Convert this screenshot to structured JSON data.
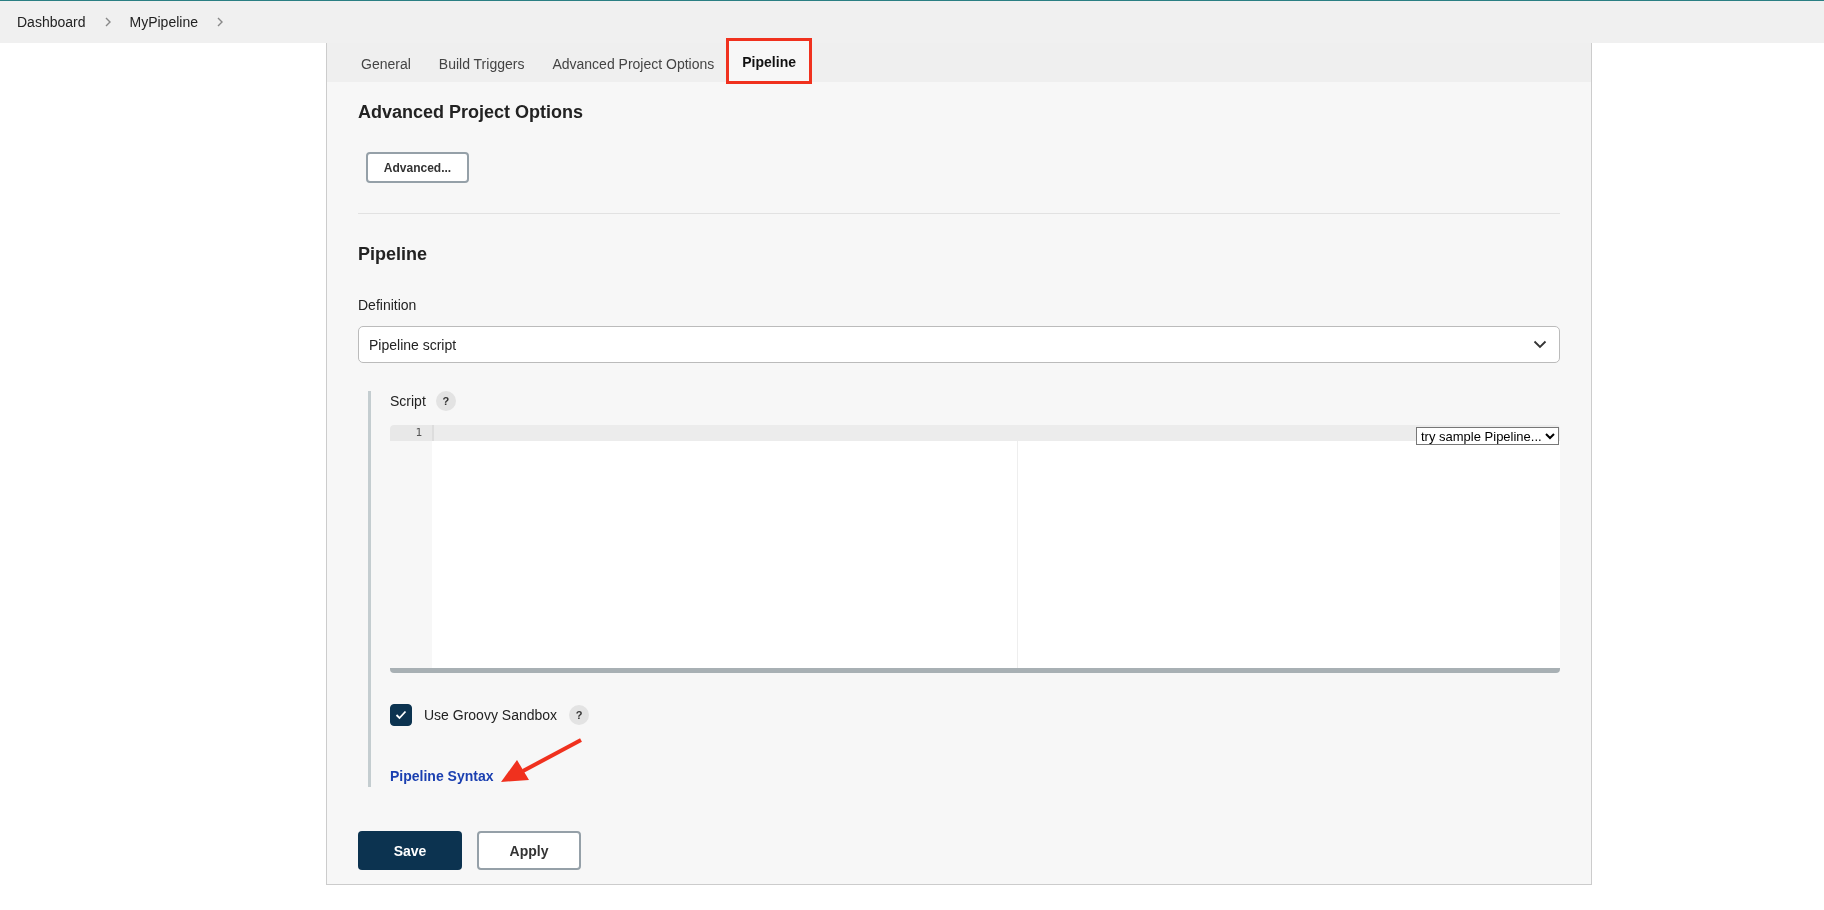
{
  "breadcrumbs": [
    {
      "label": "Dashboard"
    },
    {
      "label": "MyPipeline"
    }
  ],
  "tabs": [
    {
      "label": "General",
      "selected": false,
      "highlighted": false
    },
    {
      "label": "Build Triggers",
      "selected": false,
      "highlighted": false
    },
    {
      "label": "Advanced Project Options",
      "selected": false,
      "highlighted": false
    },
    {
      "label": "Pipeline",
      "selected": true,
      "highlighted": true
    }
  ],
  "advanced_section": {
    "title": "Advanced Project Options",
    "button": "Advanced..."
  },
  "pipeline_section": {
    "title": "Pipeline",
    "definition_label": "Definition",
    "definition_value": "Pipeline script",
    "script_label": "Script",
    "script_help": "?",
    "line_numbers": [
      "1"
    ],
    "sample_select": "try sample Pipeline...",
    "sandbox": {
      "label": "Use Groovy Sandbox",
      "checked": true,
      "help": "?"
    },
    "syntax_link": {
      "label": "Pipeline Syntax",
      "arrow_pointer": true
    }
  },
  "buttons": [
    {
      "label": "Save",
      "kind": "primary"
    },
    {
      "label": "Apply",
      "kind": "secondary"
    }
  ]
}
